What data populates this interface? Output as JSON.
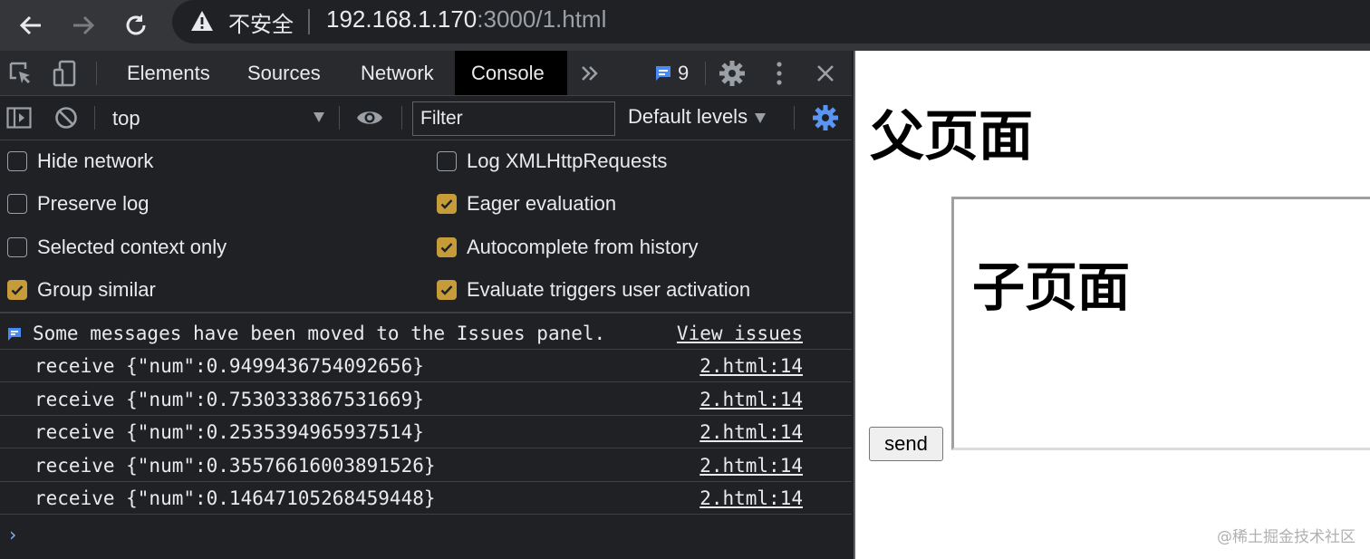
{
  "address_bar": {
    "security_label": "不安全",
    "url_host": "192.168.1.170",
    "url_path": ":3000/1.html"
  },
  "devtools": {
    "tabs": [
      {
        "label": "Elements"
      },
      {
        "label": "Sources"
      },
      {
        "label": "Network"
      },
      {
        "label": "Console"
      }
    ],
    "active_tab": "Console",
    "issues_count": "9",
    "console_toolbar": {
      "context": "top",
      "filter_placeholder": "Filter",
      "levels": "Default levels"
    },
    "settings": {
      "hide_network": {
        "label": "Hide network",
        "checked": false
      },
      "preserve_log": {
        "label": "Preserve log",
        "checked": false
      },
      "selected_context_only": {
        "label": "Selected context only",
        "checked": false
      },
      "group_similar": {
        "label": "Group similar",
        "checked": true
      },
      "log_xhr": {
        "label": "Log XMLHttpRequests",
        "checked": false
      },
      "eager_evaluation": {
        "label": "Eager evaluation",
        "checked": true
      },
      "autocomplete_history": {
        "label": "Autocomplete from history",
        "checked": true
      },
      "evaluate_triggers": {
        "label": "Evaluate triggers user activation",
        "checked": true
      }
    },
    "issues_message": {
      "text": "Some messages have been moved to the Issues panel.",
      "link": "View issues"
    },
    "messages": [
      {
        "text": "receive {\"num\":0.9499436754092656}",
        "source": "2.html:14"
      },
      {
        "text": "receive {\"num\":0.7530333867531669}",
        "source": "2.html:14"
      },
      {
        "text": "receive {\"num\":0.2535394965937514}",
        "source": "2.html:14"
      },
      {
        "text": "receive {\"num\":0.35576616003891526}",
        "source": "2.html:14"
      },
      {
        "text": "receive {\"num\":0.14647105268459448}",
        "source": "2.html:14"
      }
    ],
    "prompt": "›"
  },
  "page": {
    "title": "父页面",
    "send_label": "send",
    "child_title": "子页面",
    "watermark": "@稀土掘金技术社区"
  },
  "colors": {
    "checkbox_checked": "#c69c3b",
    "accent_blue": "#8ab4f8",
    "devtools_bg": "#202124"
  }
}
